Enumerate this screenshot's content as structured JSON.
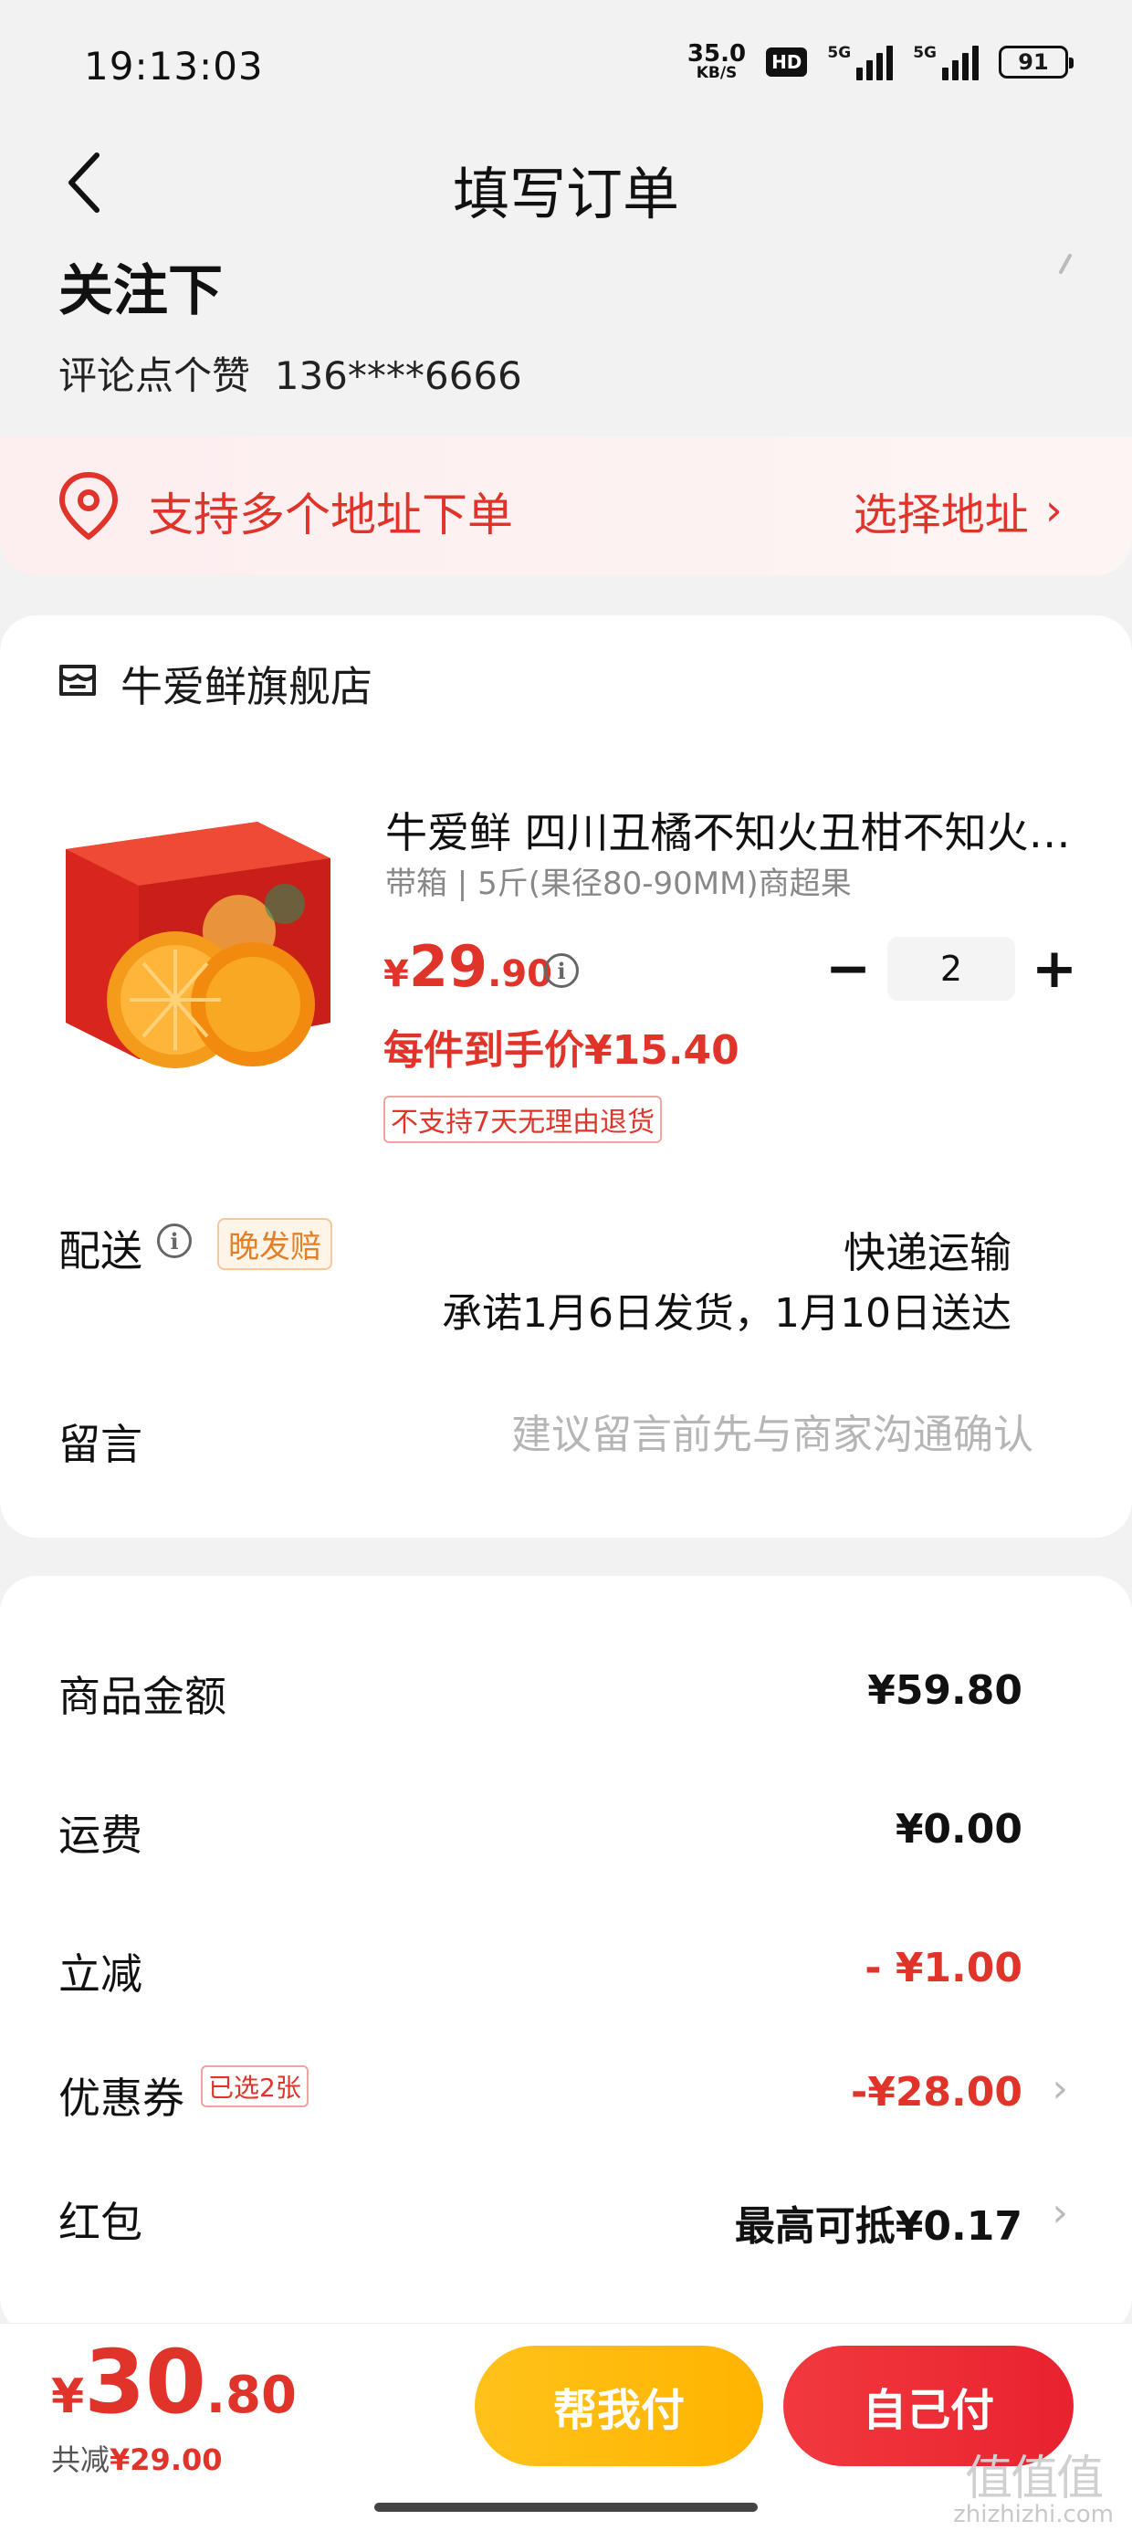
{
  "status_bar": {
    "time": "19:13:03",
    "net_speed": "35.0",
    "net_unit": "KB/S",
    "hd_badge": "HD",
    "sig1_label": "5G",
    "sig2_label": "5G",
    "battery": "91"
  },
  "nav": {
    "title": "填写订单",
    "back_icon": "chevron-left-icon"
  },
  "address": {
    "name": "关注下",
    "detail": "评论点个赞",
    "phone": "136****6666",
    "multi_text": "支持多个地址下单",
    "choose_label": "选择地址",
    "choose_chevron": "›"
  },
  "product": {
    "store_name": "牛爱鲜旗舰店",
    "title": "牛爱鲜 四川丑橘不知火丑柑不知火桔子新鲜水果",
    "spec": "带箱 | 5斤(果径80-90MM)商超果",
    "price_currency": "¥",
    "price_int": "29",
    "price_dec": ".90",
    "unit_price": "每件到手价¥15.40",
    "no_return": "不支持7天无理由退货",
    "quantity": "2",
    "minus": "−",
    "plus": "+",
    "info_glyph": "i"
  },
  "delivery": {
    "label": "配送",
    "late_badge": "晚发赔",
    "method": "快递运输",
    "promise": "承诺1月6日发货，1月10日送达"
  },
  "message": {
    "label": "留言",
    "placeholder": "建议留言前先与商家沟通确认"
  },
  "price_detail": {
    "goods_label": "商品金额",
    "goods_value": "¥59.80",
    "shipping_label": "运费",
    "shipping_value": "¥0.00",
    "instant_label": "立减",
    "instant_value": "- ¥1.00",
    "coupon_label": "优惠券",
    "coupon_badge": "已选2张",
    "coupon_value": "-¥28.00",
    "redpacket_label": "红包",
    "redpacket_value": "最高可抵¥0.17",
    "chevron": "›"
  },
  "footer": {
    "total_currency": "¥",
    "total_int": "30",
    "total_dec": ".80",
    "saved_label": "共减",
    "saved_value": "¥29.00",
    "help_pay": "帮我付",
    "self_pay": "自己付"
  },
  "watermark": {
    "big": "值值值",
    "small": "zhizhizhi.com"
  },
  "colors": {
    "accent": "#e0342a",
    "help_button": "#ffb400",
    "self_button": "#e8222f",
    "badge_orange": "#e2802a"
  }
}
